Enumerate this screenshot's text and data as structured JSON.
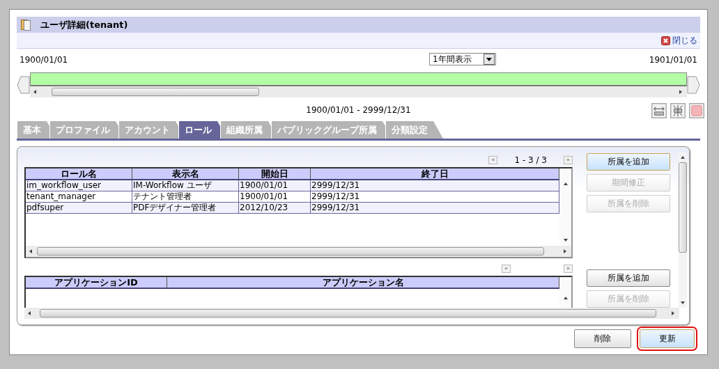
{
  "window": {
    "title": "ユーザ詳細(tenant)",
    "close_link": "閉じる"
  },
  "timeline": {
    "start_date": "1900/01/01",
    "period_select": "1年間表示",
    "end_date": "1901/01/01",
    "range": "1900/01/01 - 2999/12/31"
  },
  "tabs": [
    {
      "label": "基本",
      "selected": false
    },
    {
      "label": "プロファイル",
      "selected": false
    },
    {
      "label": "アカウント",
      "selected": false
    },
    {
      "label": "ロール",
      "selected": true
    },
    {
      "label": "組織所属",
      "selected": false
    },
    {
      "label": "パブリックグループ所属",
      "selected": false
    },
    {
      "label": "分類設定",
      "selected": false
    }
  ],
  "roles": {
    "prev": "«",
    "pager": "1 - 3 / 3",
    "next": "»",
    "columns": [
      "ロール名",
      "表示名",
      "開始日",
      "終了日"
    ],
    "rows": [
      [
        "im_workflow_user",
        "IM-Workflow ユーザ",
        "1900/01/01",
        "2999/12/31"
      ],
      [
        "tenant_manager",
        "テナント管理者",
        "1900/01/01",
        "2999/12/31"
      ],
      [
        "pdfsuper",
        "PDFデザイナー管理者",
        "2012/10/23",
        "2999/12/31"
      ]
    ]
  },
  "role_buttons": [
    {
      "label": "所属を追加",
      "disabled": false,
      "highlighted": true
    },
    {
      "label": "期間修正",
      "disabled": true,
      "highlighted": false
    },
    {
      "label": "所属を削除",
      "disabled": true,
      "highlighted": false
    }
  ],
  "applications": {
    "prev": "«",
    "next": "»",
    "columns": [
      "アプリケーションID",
      "アプリケーション名"
    ]
  },
  "application_buttons": [
    {
      "label": "所属を追加",
      "disabled": false,
      "highlighted": false
    },
    {
      "label": "所属を削除",
      "disabled": true,
      "highlighted": false
    }
  ],
  "footer_buttons": [
    {
      "label": "削除",
      "highlighted": false,
      "marked": false
    },
    {
      "label": "更新",
      "highlighted": true,
      "marked": true
    }
  ]
}
